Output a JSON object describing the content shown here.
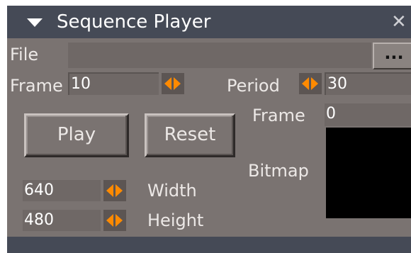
{
  "window": {
    "title": "Sequence Player",
    "close_glyph": "✕"
  },
  "file": {
    "label": "File",
    "value": "",
    "browse_label": "..."
  },
  "frame_input": {
    "label": "Frame",
    "value": "10"
  },
  "period": {
    "label": "Period",
    "value": "30"
  },
  "buttons": {
    "play": "Play",
    "reset": "Reset"
  },
  "frame_display": {
    "label": "Frame",
    "value": "0"
  },
  "bitmap": {
    "label": "Bitmap"
  },
  "width": {
    "label": "Width",
    "value": "640"
  },
  "height": {
    "label": "Height",
    "value": "480"
  },
  "colors": {
    "panel_bg": "#7a7371",
    "titlebar_bg": "#454a56",
    "spinner_arrow": "#ff8a00"
  },
  "icons": [
    "chevron-down-icon",
    "close-icon",
    "spinner-arrows-icon"
  ]
}
